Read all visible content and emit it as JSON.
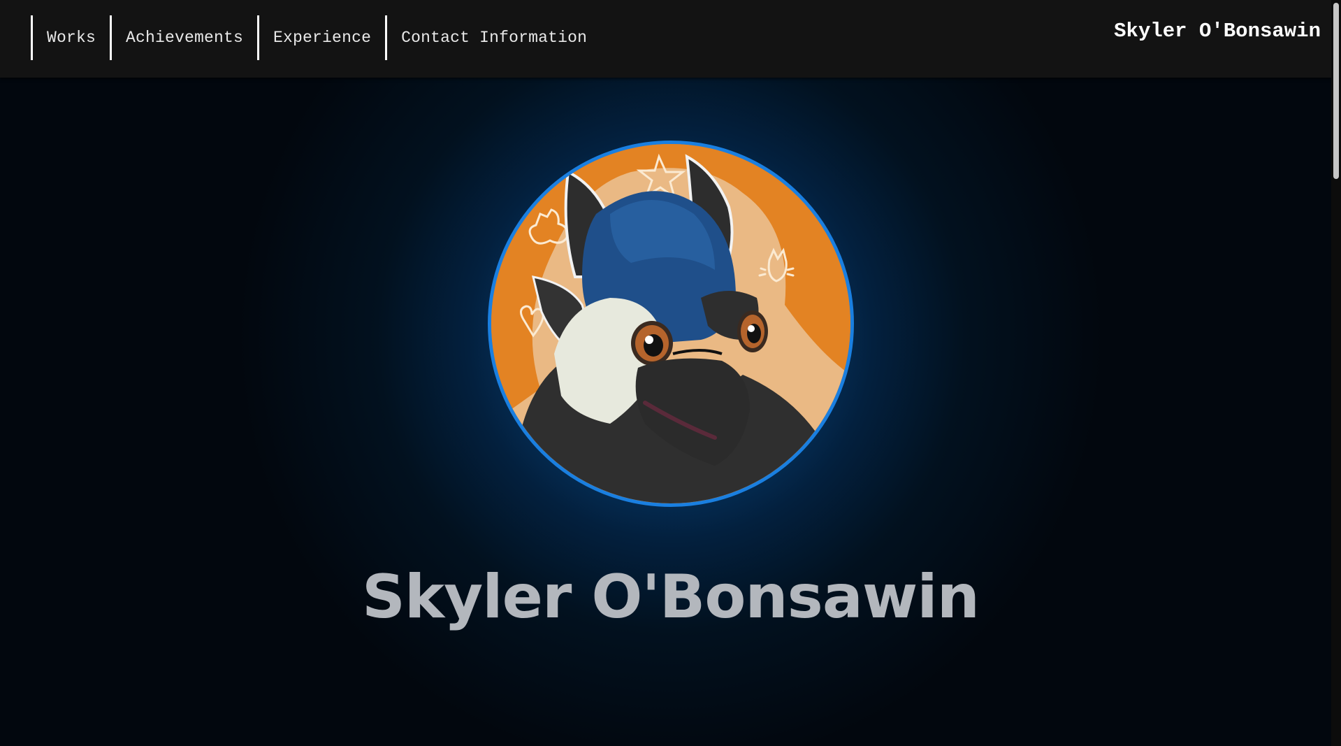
{
  "nav": {
    "links": [
      {
        "label": "Works"
      },
      {
        "label": "Achievements"
      },
      {
        "label": "Experience"
      },
      {
        "label": "Contact Information"
      }
    ],
    "brand": "Skyler O'Bonsawin"
  },
  "hero": {
    "name": "Skyler O'Bonsawin",
    "avatar": {
      "description_icon": "bird-character-avatar-icon",
      "background_color": "#e38323",
      "ring_color": "#1a7fe0"
    }
  },
  "colors": {
    "navbar": "#131313",
    "page_background": "#02070e",
    "glow": "#0b4f8f",
    "name_text": "#b3b7bd"
  }
}
